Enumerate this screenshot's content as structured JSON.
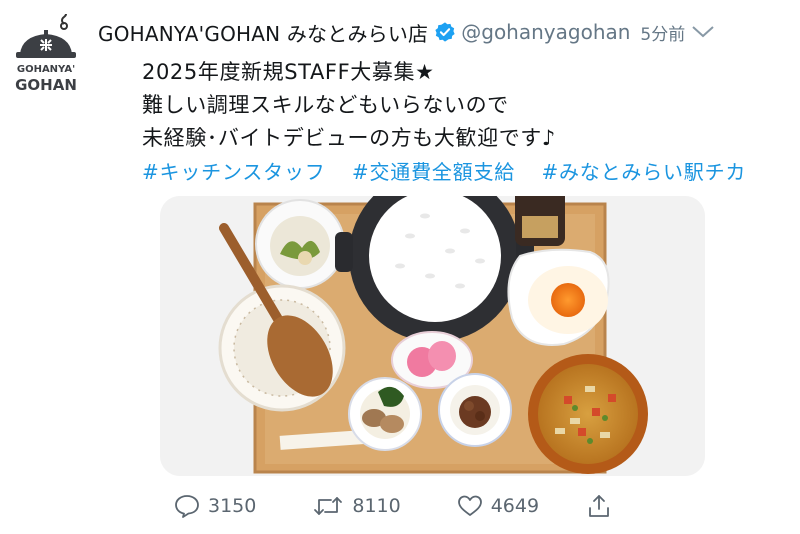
{
  "account": {
    "logo_line1": "GOHANYA'",
    "logo_line2": "GOHAN",
    "display_name": "GOHANYA'GOHAN みなとみらい店",
    "handle": "@gohanyagohan",
    "time": "5分前"
  },
  "tweet": {
    "lines": [
      "2025年度新規STAFF大募集★",
      "難しい調理スキルなどもいらないので",
      "未経験･バイトデビューの方も大歓迎です♪"
    ],
    "hashtags": [
      "#キッチンスタッフ",
      "#交通費全額支給",
      "#みなとみらい駅チカ"
    ]
  },
  "actions": {
    "replies": "3150",
    "retweets": "8110",
    "likes": "4649"
  },
  "icons": {
    "verified": "verified-badge-icon",
    "chevron": "chevron-down-icon",
    "reply": "reply-icon",
    "retweet": "retweet-icon",
    "like": "heart-icon",
    "share": "share-icon"
  },
  "colors": {
    "link": "#1b95e0",
    "verified": "#1da1f2",
    "muted": "#657786"
  }
}
